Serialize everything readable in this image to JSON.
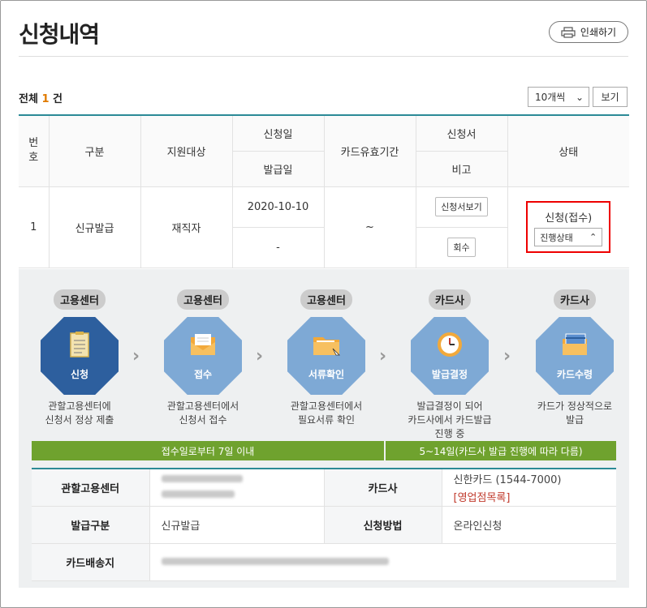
{
  "page": {
    "title": "신청내역",
    "print_label": "인쇄하기"
  },
  "summary": {
    "prefix": "전체",
    "count": "1",
    "suffix": "건"
  },
  "controls": {
    "page_size": "10개씩",
    "view_label": "보기"
  },
  "table": {
    "headers": {
      "no": "번호",
      "category": "구분",
      "target": "지원대상",
      "apply_date": "신청일",
      "issue_date": "발급일",
      "validity": "카드유효기간",
      "form": "신청서",
      "note": "비고",
      "status": "상태"
    },
    "row": {
      "no": "1",
      "category": "신규발급",
      "target": "재직자",
      "apply_date": "2020-10-10",
      "issue_date": "-",
      "validity": "~",
      "form_btn": "신청서보기",
      "note_btn": "회수",
      "status": "신청(접수)",
      "progress_btn": "진행상태"
    }
  },
  "steps": [
    {
      "org": "고용센터",
      "name": "신청",
      "desc1": "관할고용센터에",
      "desc2": "신청서 정상 제출",
      "desc3": "",
      "color": "#2d5f9e",
      "icon": "clipboard-icon"
    },
    {
      "org": "고용센터",
      "name": "접수",
      "desc1": "관할고용센터에서",
      "desc2": "신청서 접수",
      "desc3": "",
      "color": "#7ea9d5",
      "icon": "envelope-icon"
    },
    {
      "org": "고용센터",
      "name": "서류확인",
      "desc1": "관할고용센터에서",
      "desc2": "필요서류 확인",
      "desc3": "",
      "color": "#7ea9d5",
      "icon": "folder-icon"
    },
    {
      "org": "카드사",
      "name": "발급결정",
      "desc1": "발급결정이 되어",
      "desc2": "카드사에서 카드발급",
      "desc3": "진행 중",
      "color": "#7ea9d5",
      "icon": "clock-icon"
    },
    {
      "org": "카드사",
      "name": "카드수령",
      "desc1": "카드가 정상적으로",
      "desc2": "발급",
      "desc3": "",
      "color": "#7ea9d5",
      "icon": "card-icon"
    }
  ],
  "bars": {
    "left": "접수일로부터 7일 이내",
    "right": "5~14일(카드사 발급 진행에 따라 다름)"
  },
  "info": {
    "center_label": "관할고용센터",
    "card_company_label": "카드사",
    "card_company": "신한카드 (1544-7000)",
    "branch_link": "[영업점목록]",
    "issue_type_label": "발급구분",
    "issue_type": "신규발급",
    "method_label": "신청방법",
    "method": "온라인신청",
    "delivery_label": "카드배송지"
  }
}
